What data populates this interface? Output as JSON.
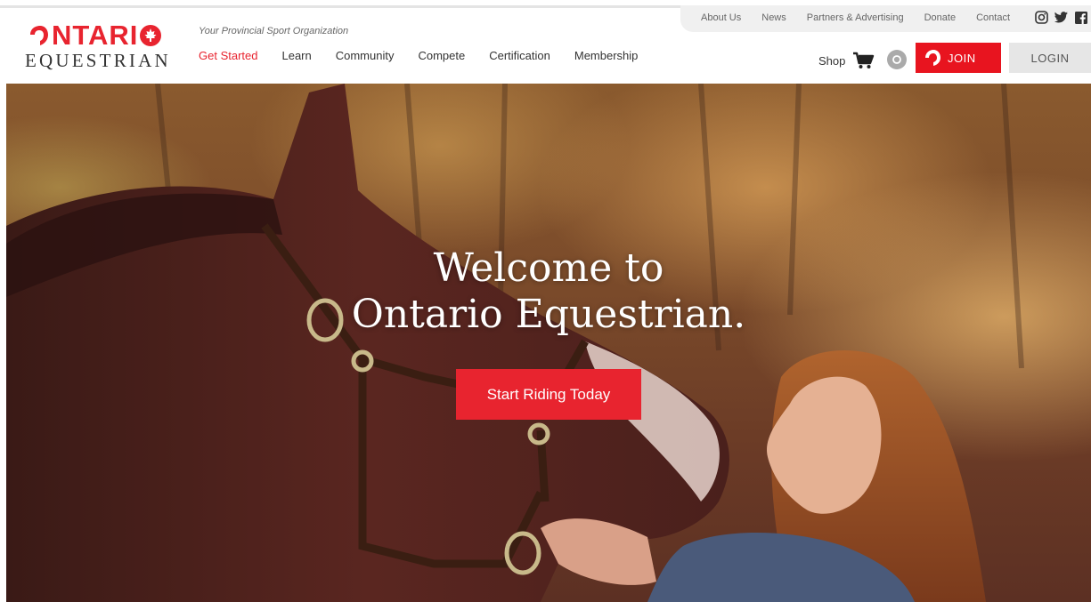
{
  "header": {
    "logo": {
      "top_word": "NTARI",
      "bottom_word": "EQUESTRIAN"
    },
    "tagline": "Your Provincial Sport Organization",
    "nav": [
      {
        "label": "Get Started",
        "active": true
      },
      {
        "label": "Learn",
        "active": false
      },
      {
        "label": "Community",
        "active": false
      },
      {
        "label": "Compete",
        "active": false
      },
      {
        "label": "Certification",
        "active": false
      },
      {
        "label": "Membership",
        "active": false
      }
    ],
    "utility_links": [
      "About Us",
      "News",
      "Partners & Advertising",
      "Donate",
      "Contact"
    ],
    "social": [
      "instagram-icon",
      "twitter-icon",
      "facebook-icon"
    ],
    "shop_label": "Shop",
    "join_label": "JOIN",
    "login_label": "LOGIN"
  },
  "hero": {
    "title_line1": "Welcome to",
    "title_line2": "Ontario Equestrian.",
    "cta_label": "Start Riding Today"
  },
  "colors": {
    "brand_red": "#e8242f",
    "join_red": "#e8141f",
    "login_gray": "#e6e6e6",
    "utility_bg": "#f0f0f0"
  }
}
